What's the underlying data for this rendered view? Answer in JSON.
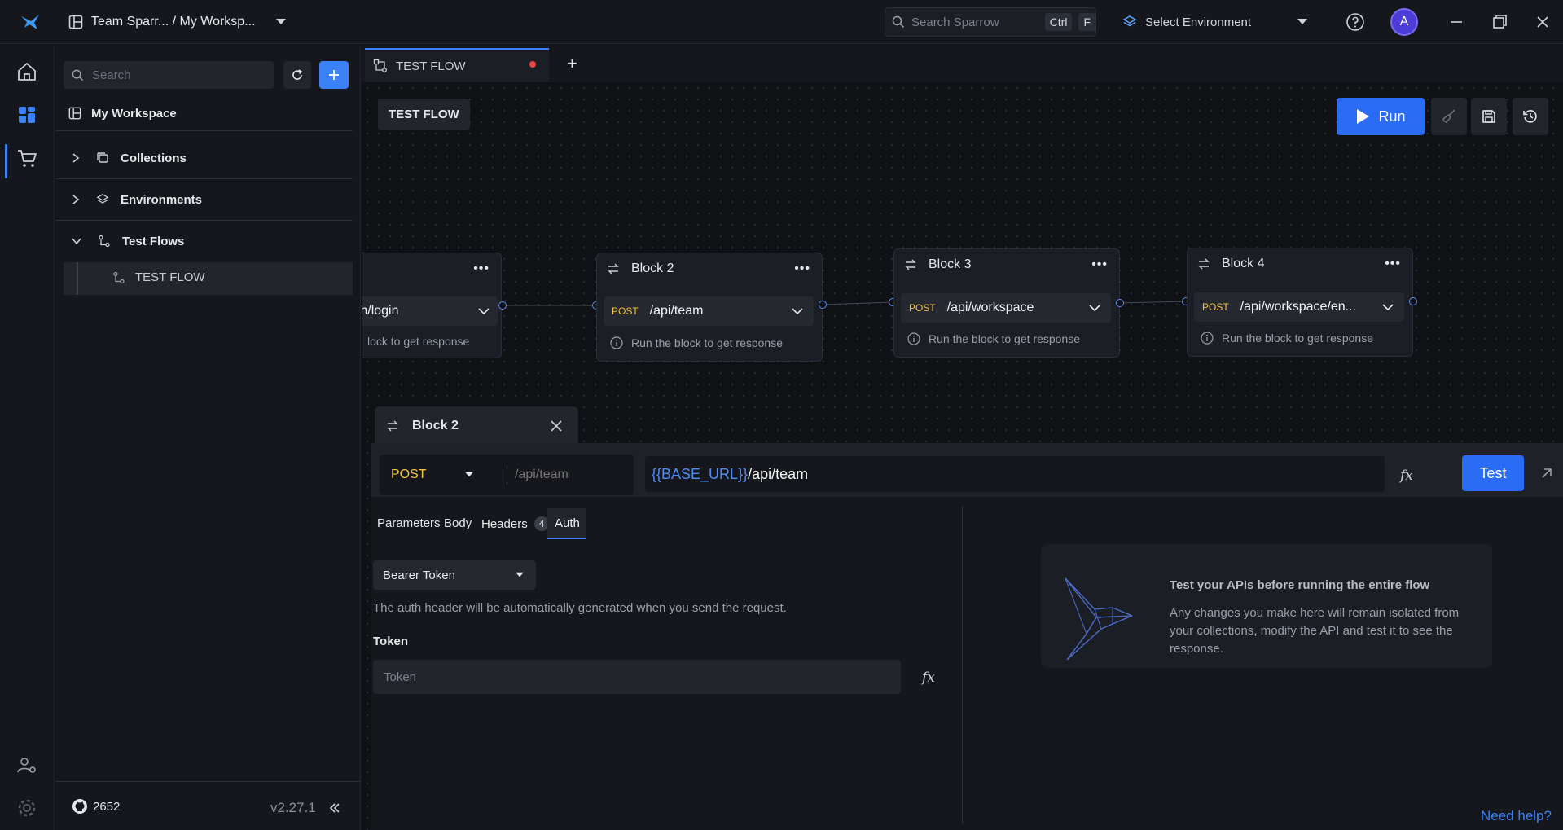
{
  "topbar": {
    "workspace_path": "Team Sparr... / My Worksp...",
    "search_placeholder": "Search Sparrow",
    "search_kbd_ctrl": "Ctrl",
    "search_kbd_key": "F",
    "environment_label": "Select Environment",
    "avatar_initial": "A"
  },
  "sidebar": {
    "search_placeholder": "Search",
    "workspace_name": "My Workspace",
    "items": [
      {
        "label": "Collections",
        "icon": "collections-icon"
      },
      {
        "label": "Environments",
        "icon": "environments-icon"
      },
      {
        "label": "Test Flows",
        "icon": "test-flows-icon"
      }
    ],
    "flow_item": "TEST FLOW",
    "github_stars": "2652",
    "version": "v2.27.1"
  },
  "tabs": [
    {
      "label": "TEST FLOW",
      "unsaved": true
    }
  ],
  "canvas": {
    "flow_name": "TEST FLOW",
    "run_label": "Run",
    "blocks": [
      {
        "title": "",
        "method": "",
        "path": "uth/login",
        "note": "lock to get response"
      },
      {
        "title": "Block 2",
        "method": "POST",
        "path": "/api/team",
        "note": "Run the block to get response"
      },
      {
        "title": "Block 3",
        "method": "POST",
        "path": "/api/workspace",
        "note": "Run the block to get response"
      },
      {
        "title": "Block 4",
        "method": "POST",
        "path": "/api/workspace/en...",
        "note": "Run the block to get response"
      }
    ]
  },
  "panel": {
    "title": "Block 2",
    "method": "POST",
    "path_placeholder": "/api/team",
    "url_variable": "{{BASE_URL}}",
    "url_path": "/api/team",
    "test_label": "Test",
    "sub_tabs": [
      "Parameters",
      "Body",
      "Headers",
      "Auth"
    ],
    "headers_count": "4",
    "auth_type": "Bearer Token",
    "auth_note": "The auth header will be automatically generated when you send the request.",
    "token_label": "Token",
    "token_placeholder": "Token",
    "info_title": "Test your APIs before running the entire flow",
    "info_text": "Any changes you make here will remain isolated from your collections, modify the API and test it to see the response.",
    "help_link": "Need help?"
  },
  "colors": {
    "accent": "#2b6cf5",
    "post_method": "#f5c344",
    "unsaved_dot": "#ef4444",
    "url_variable": "#4f8df7"
  }
}
